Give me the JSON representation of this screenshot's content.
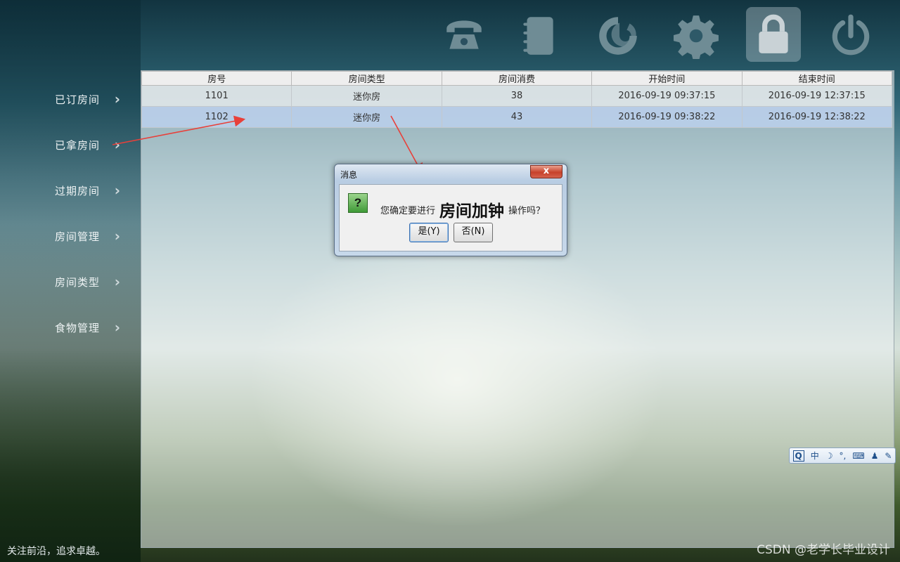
{
  "toolbar": {
    "icons": [
      "phone-icon",
      "address-book-icon",
      "refresh-icon",
      "gear-icon",
      "lock-icon",
      "power-icon"
    ],
    "active": "lock-icon"
  },
  "sidebar": {
    "items": [
      {
        "label": "已订房间"
      },
      {
        "label": "已拿房间"
      },
      {
        "label": "过期房间"
      },
      {
        "label": "房间管理"
      },
      {
        "label": "房间类型"
      },
      {
        "label": "食物管理"
      }
    ]
  },
  "table": {
    "columns": [
      "房号",
      "房间类型",
      "房间消费",
      "开始时间",
      "结束时间"
    ],
    "rows": [
      [
        "1101",
        "迷你房",
        "38",
        "2016-09-19 09:37:15",
        "2016-09-19 12:37:15"
      ],
      [
        "1102",
        "迷你房",
        "43",
        "2016-09-19 09:38:22",
        "2016-09-19 12:38:22"
      ]
    ],
    "selected_row": 1
  },
  "dialog": {
    "title": "消息",
    "close_label": "x",
    "message_prefix": "您确定要进行",
    "message_emphasis": "房间加钟",
    "message_suffix": "操作吗？",
    "yes_label": "是(Y)",
    "no_label": "否(N)"
  },
  "ime": {
    "mode": "中"
  },
  "footer": {
    "slogan": "关注前沿，追求卓越。",
    "watermark": "CSDN @老学长毕业设计"
  },
  "colors": {
    "selected_row": "#b8cee8",
    "annotation_arrow": "#e8403a"
  }
}
